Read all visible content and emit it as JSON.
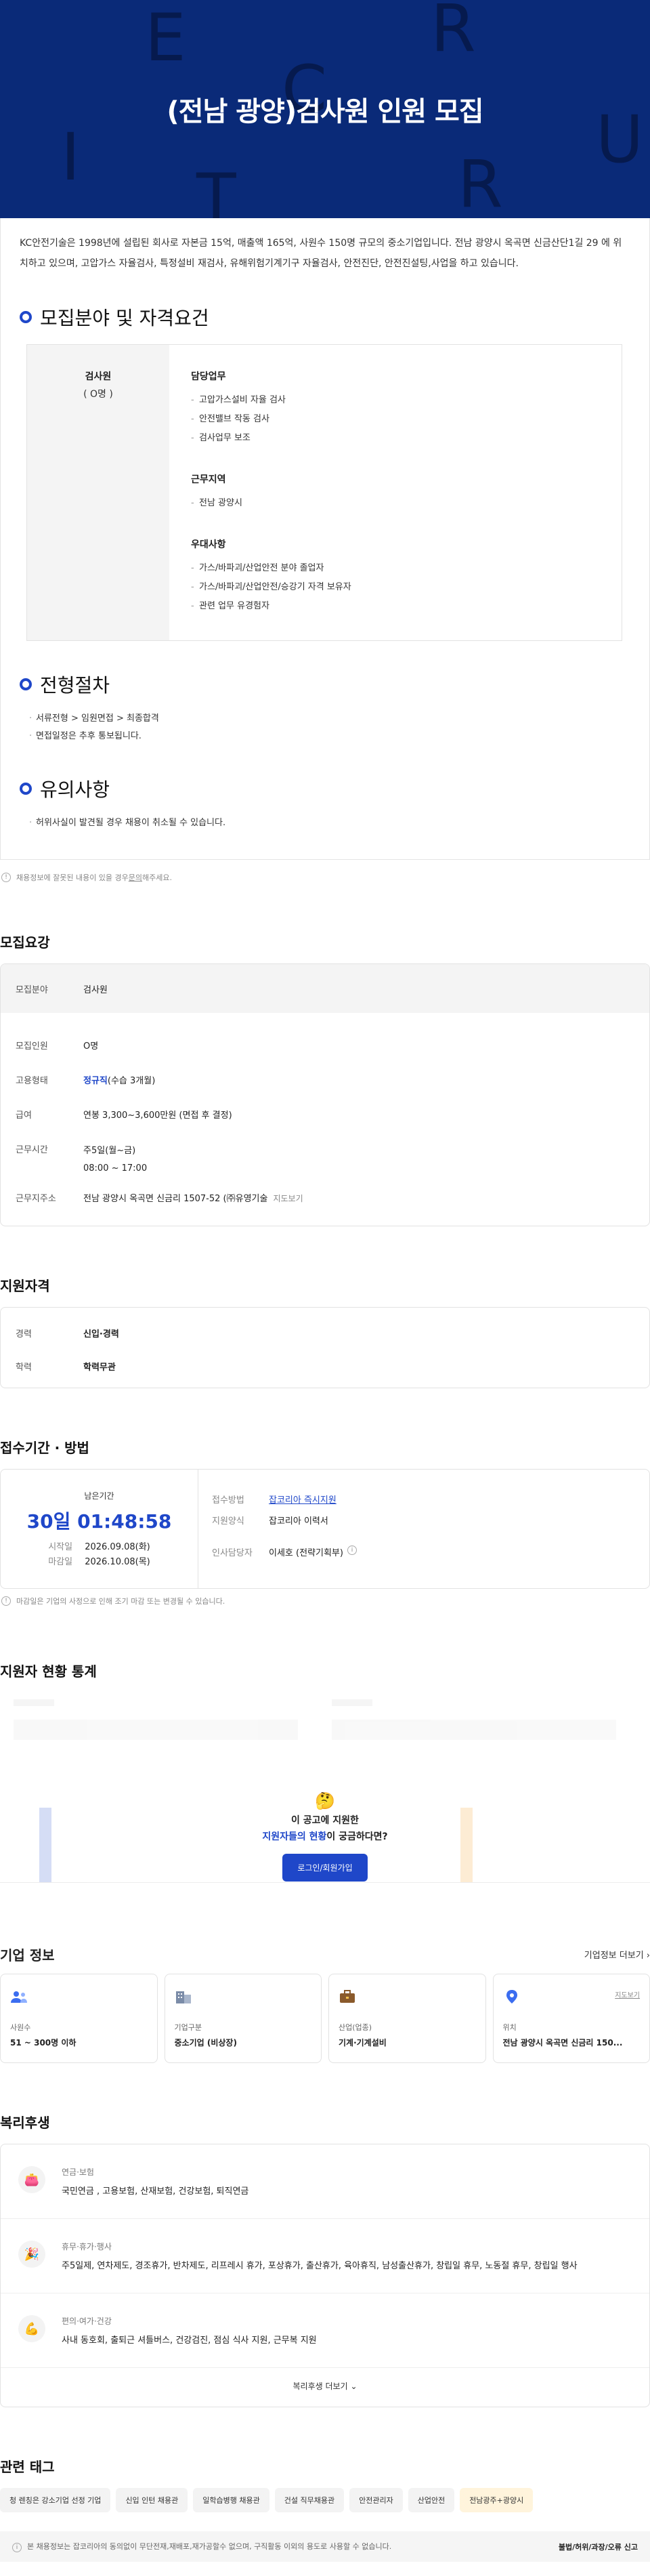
{
  "hero": {
    "title": "(전남 광양)검사원 인원 모집",
    "letters": [
      "E",
      "R",
      "C",
      "I",
      "U",
      "T",
      "R"
    ]
  },
  "intro": "KC안전기술은 1998년에 설립된 회사로 자본금 15억, 매출액 165억, 사원수 150명 규모의 중소기업입니다. 전남 광양시 옥곡면 신금산단1길 29 에 위치하고 있으며, 고압가스 자율검사, 특정설비 재검사, 유해위험기계기구 자율검사, 안전진단, 안전진설팅,사업을 하고 있습니다.",
  "recruit": {
    "title": "모집분야 및 자격요건",
    "position": "검사원",
    "count": "( O명 )",
    "blocks": [
      {
        "head": "담당업무",
        "items": [
          "고압가스설비 자율 검사",
          "안전밸브 작동 검사",
          "검사업무 보조"
        ]
      },
      {
        "head": "근무지역",
        "items": [
          "전남 광양시"
        ]
      },
      {
        "head": "우대사항",
        "items": [
          "가스/바파괴/산업안전 분야 졸업자",
          "가스/바파괴/산업안전/승강기 자격 보유자",
          "관련 업무 유경험자"
        ]
      }
    ]
  },
  "process": {
    "title": "전형절차",
    "items": [
      "서류전형 > 임원면접 > 최종합격",
      "면접일정은 추후 통보됩니다."
    ]
  },
  "caution": {
    "title": "유의사항",
    "items": [
      "허위사실이 발견될 경우 채용이 취소될 수 있습니다."
    ]
  },
  "notice": {
    "pre": "채용정보에 잘못된 내용이 있을 경우 ",
    "link": "문의",
    "post": "해주세요."
  },
  "requirements": {
    "title": "모집요강",
    "field_label": "모집분야",
    "field_value": "검사원",
    "count_label": "모집인원",
    "count_value": "O명",
    "type_label": "고용형태",
    "type_value": "정규직",
    "type_note": "(수습 3개월)",
    "salary_label": "급여",
    "salary_value": "연봉 3,300~3,600만원 (면접 후 결정)",
    "hours_label": "근무시간",
    "hours_1": "주5일(월~금)",
    "hours_2": "08:00 ~ 17:00",
    "addr_label": "근무지주소",
    "addr_value": "전남 광양시 옥곡면 신금리 1507-52 (㈜유영기술",
    "addr_map": "지도보기"
  },
  "qualifications": {
    "title": "지원자격",
    "career_label": "경력",
    "career_value": "신입·경력",
    "edu_label": "학력",
    "edu_value": "학력무관"
  },
  "apply": {
    "title": "접수기간 · 방법",
    "remaining_label": "남은기간",
    "remaining_value": "30일 01:48:58",
    "start_label": "시작일",
    "start_value": "2026.09.08(화)",
    "end_label": "마감일",
    "end_value": "2026.10.08(목)",
    "method_label": "접수방법",
    "method_value": "잡코리아 즉시지원",
    "form_label": "지원양식",
    "form_value": "잡코리아 이력서",
    "manager_label": "인사담당자",
    "manager_value": "이세호 (전략기획부)",
    "notice": "마감일은 기업의 사정으로 인해 조기 마감 또는 변경될 수 있습니다."
  },
  "stats": {
    "title": "지원자 현황 통계",
    "q1": "이 공고에 지원한",
    "q2_hl": "지원자들의 현황",
    "q2_rest": "이 궁금하다면?",
    "button": "로그인/회원가입"
  },
  "company": {
    "title": "기업 정보",
    "more": "기업정보 더보기",
    "cards": [
      {
        "label": "사원수",
        "value": "51 ~ 300명 이하",
        "icon": "people-icon"
      },
      {
        "label": "기업구분",
        "value": "중소기업 (비상장)",
        "icon": "building-icon"
      },
      {
        "label": "산업(업종)",
        "value": "기계·기계설비",
        "icon": "briefcase-icon"
      },
      {
        "label": "위치",
        "value": "전남 광양시 옥곡면 신금리 150...",
        "icon": "location-pin-icon",
        "map": "지도보기"
      }
    ]
  },
  "welfare": {
    "title": "복리후생",
    "items": [
      {
        "icon": "piggy-bank-icon",
        "glyph": "👛",
        "title": "연금·보험",
        "value": "국민연금 , 고용보험, 산재보험, 건강보험, 퇴직연금"
      },
      {
        "icon": "party-icon",
        "glyph": "🎉",
        "title": "휴무·휴가·행사",
        "value": "주5일제, 연차제도, 경조휴가, 반차제도, 리프레시 휴가, 포상휴가, 출산휴가, 육아휴직, 남성출산휴가, 창립일 휴무, 노동절 휴무, 창립일 행사"
      },
      {
        "icon": "muscle-icon",
        "glyph": "💪",
        "title": "편의·여가·건강",
        "value": "사내 동호회, 출퇴근 셔틀버스, 건강검진, 점심 식사 지원, 근무복 지원"
      }
    ],
    "more": "복리후생 더보기"
  },
  "tags": {
    "title": "관련 태그",
    "items": [
      "청 렌칭은 강소기업 선정 기업",
      "신입 인턴 채용관",
      "일학습병행 채용관",
      "건설 직무채용관",
      "안전관리자",
      "산업안전",
      "전남광주+광양시"
    ]
  },
  "footer": {
    "left": "본 채용정보는 잡코리아의 동의없이 무단전재,재배포,재가공할수 없으며, 구직활동 이외의 용도로 사용할 수 없습니다.",
    "right": "불법/허위/과장/오류 신고"
  },
  "colors": {
    "hero_bg": "#0a2a78",
    "accent": "#1f47c9",
    "tag_highlight": "#fff4dc"
  }
}
